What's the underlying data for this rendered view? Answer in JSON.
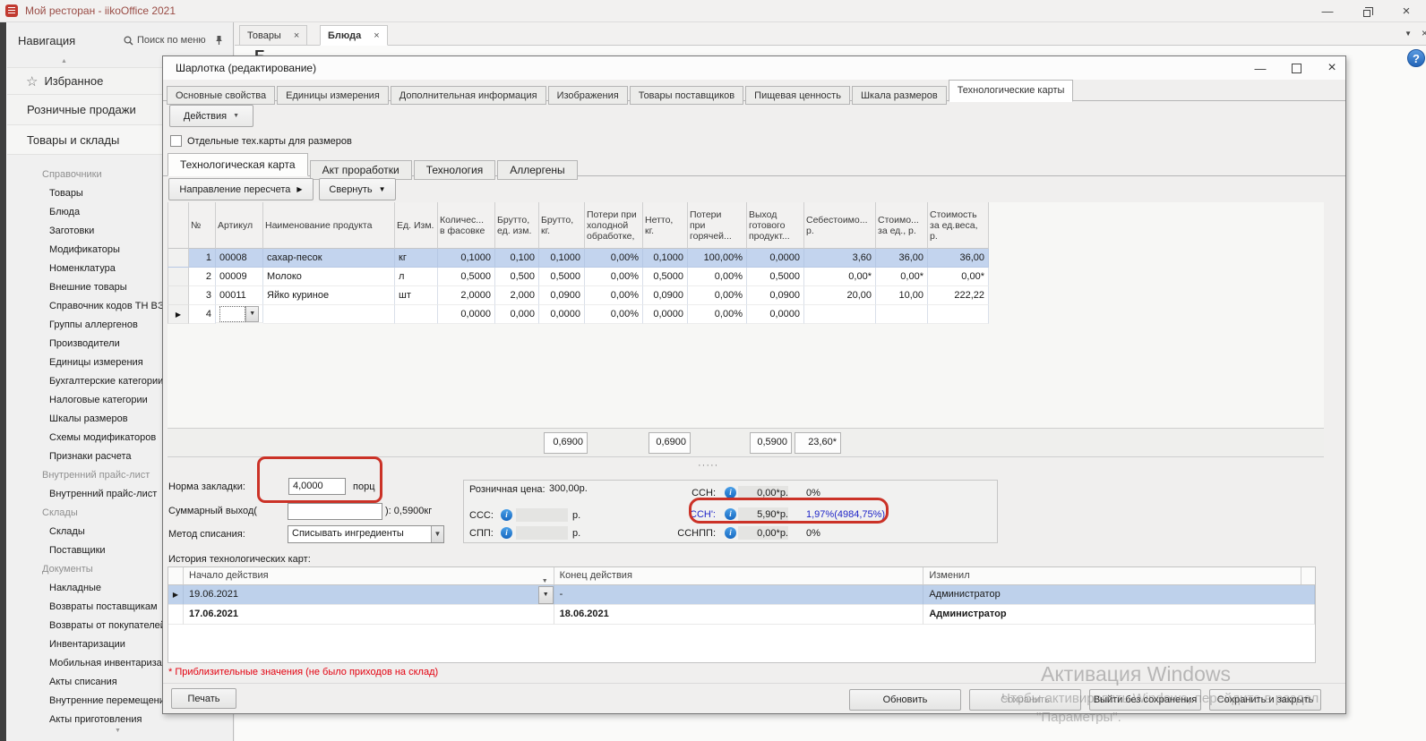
{
  "window": {
    "title": "Мой ресторан - iikoOffice 2021"
  },
  "sidebar": {
    "header": {
      "title": "Навигация",
      "search_placeholder": "Поиск по меню"
    },
    "accordion": [
      {
        "label": "Избранное",
        "icon": "star"
      },
      {
        "label": "Розничные продажи"
      },
      {
        "label": "Товары и склады",
        "active": true
      }
    ],
    "items": [
      {
        "label": "Справочники",
        "type": "section"
      },
      {
        "label": "Товары"
      },
      {
        "label": "Блюда"
      },
      {
        "label": "Заготовки"
      },
      {
        "label": "Модификаторы"
      },
      {
        "label": "Номенклатура"
      },
      {
        "label": "Внешние товары"
      },
      {
        "label": "Справочник кодов ТН ВЭД"
      },
      {
        "label": "Группы аллергенов"
      },
      {
        "label": "Производители"
      },
      {
        "label": "Единицы измерения"
      },
      {
        "label": "Бухгалтерские категории"
      },
      {
        "label": "Налоговые категории"
      },
      {
        "label": "Шкалы размеров"
      },
      {
        "label": "Схемы модификаторов"
      },
      {
        "label": "Признаки расчета"
      },
      {
        "label": "Внутренний прайс-лист",
        "type": "section"
      },
      {
        "label": "Внутренний прайс-лист"
      },
      {
        "label": "Склады",
        "type": "section"
      },
      {
        "label": "Склады"
      },
      {
        "label": "Поставщики"
      },
      {
        "label": "Документы",
        "type": "section"
      },
      {
        "label": "Накладные"
      },
      {
        "label": "Возвраты поставщикам"
      },
      {
        "label": "Возвраты от покупателей"
      },
      {
        "label": "Инвентаризации"
      },
      {
        "label": "Мобильная инвентаризац"
      },
      {
        "label": "Акты списания"
      },
      {
        "label": "Внутренние перемещения"
      },
      {
        "label": "Акты приготовления"
      }
    ]
  },
  "doc_tabs": [
    {
      "label": "Товары"
    },
    {
      "label": "Блюда",
      "active": true
    }
  ],
  "content": {
    "heading_partial": "Б"
  },
  "dialog": {
    "title": "Шарлотка  (редактирование)",
    "tabs": [
      "Основные свойства",
      "Единицы измерения",
      "Дополнительная информация",
      "Изображения",
      "Товары поставщиков",
      "Пищевая ценность",
      "Шкала размеров",
      "Технологические карты"
    ],
    "active_tab": "Технологические карты",
    "actions_button": "Действия",
    "checkbox_label": "Отдельные тех.карты для размеров",
    "subtabs": [
      "Технологическая карта",
      "Акт проработки",
      "Технология",
      "Аллергены"
    ],
    "active_subtab": "Технологическая карта",
    "toolbar": {
      "recalc": "Направление пересчета",
      "collapse": "Свернуть"
    },
    "table": {
      "columns": [
        "№",
        "Артикул",
        "Наименование продукта",
        "Ед. Изм.",
        "Количес...\nв фасовке",
        "Брутто,\nед. изм.",
        "Брутто,\nкг.",
        "Потери при\nхолодной\nобработке,",
        "Нетто,\nкг.",
        "Потери\nпри\nгорячей...",
        "Выход\nготового\nпродукт...",
        "Себестоимо...\nр.",
        "Стоимо...\nза ед., р.",
        "Стоимость\nза ед.веса,\nр."
      ],
      "rows": [
        {
          "selected": true,
          "cells": [
            "1",
            "00008",
            "сахар-песок",
            "кг",
            "0,1000",
            "0,100",
            "0,1000",
            "0,00%",
            "0,1000",
            "100,00%",
            "0,0000",
            "3,60",
            "36,00",
            "36,00"
          ]
        },
        {
          "cells": [
            "2",
            "00009",
            "Молоко",
            "л",
            "0,5000",
            "0,500",
            "0,5000",
            "0,00%",
            "0,5000",
            "0,00%",
            "0,5000",
            "0,00*",
            "0,00*",
            "0,00*"
          ]
        },
        {
          "cells": [
            "3",
            "00011",
            "Яйко куриное",
            "шт",
            "2,0000",
            "2,000",
            "0,0900",
            "0,00%",
            "0,0900",
            "0,00%",
            "0,0900",
            "20,00",
            "10,00",
            "222,22"
          ]
        },
        {
          "editor": true,
          "cells": [
            "4",
            "",
            "",
            "",
            "0,0000",
            "0,000",
            "0,0000",
            "0,00%",
            "0,0000",
            "0,00%",
            "0,0000",
            "",
            "",
            ""
          ]
        }
      ],
      "totals": [
        "0,6900",
        "0,6900",
        "0,5900",
        "23,60*"
      ]
    },
    "splitter_dots": "·····",
    "form": {
      "norm_label": "Норма закладки:",
      "norm_value": "4,0000",
      "norm_unit": "порц",
      "sum_label": "Суммарный выход(",
      "sum_suffix": "): 0,5900кг",
      "method_label": "Метод списания:",
      "method_value": "Списывать ингредиенты"
    },
    "price_panel": {
      "retail_label": "Розничная цена:",
      "retail_value": "300,00р.",
      "unit": "р.",
      "left_rows": [
        {
          "label": "ССС:"
        },
        {
          "label": "СПП:"
        }
      ],
      "right_rows": [
        {
          "label": "ССН:",
          "value": "0,00*р.",
          "pct": "0%"
        },
        {
          "label": "ССН':",
          "value": "5,90*р.",
          "pct": "1,97%(4984,75%)",
          "highlight": true
        },
        {
          "label": "ССНПП:",
          "value": "0,00*р.",
          "pct": "0%"
        }
      ]
    },
    "history": {
      "label": "История технологических карт:",
      "columns": [
        "Начало действия",
        "Конец действия",
        "Изменил"
      ],
      "rows": [
        {
          "start": "19.06.2021",
          "end": "-",
          "user": "Администратор",
          "selected": true
        },
        {
          "start": "17.06.2021",
          "end": "18.06.2021",
          "user": "Администратор",
          "bold": true
        }
      ]
    },
    "note": "* Приблизительные значения (не было приходов на склад)",
    "buttons": {
      "print": "Печать",
      "refresh": "Обновить",
      "save": "Сохранить",
      "exit": "Выйти без сохранения",
      "save_close": "Сохранить и закрыть"
    }
  },
  "watermark": {
    "line1": "Активация Windows",
    "line2": "Чтобы активировать Windows, перейдите в раздел",
    "line3": "\"Параметры\"."
  }
}
